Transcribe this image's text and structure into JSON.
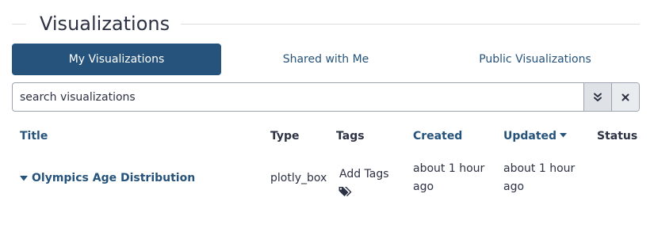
{
  "page": {
    "title": "Visualizations"
  },
  "tabs": [
    {
      "label": "My Visualizations",
      "active": true
    },
    {
      "label": "Shared with Me",
      "active": false
    },
    {
      "label": "Public Visualizations",
      "active": false
    }
  ],
  "search": {
    "placeholder": "search visualizations",
    "value": ""
  },
  "icons": {
    "advanced_search": "double-chevron-down-icon",
    "clear": "x-icon",
    "sort": "caret-down-icon",
    "expand": "caret-down-icon",
    "tags": "tags-icon"
  },
  "table": {
    "headers": {
      "title": "Title",
      "type": "Type",
      "tags": "Tags",
      "created": "Created",
      "updated": "Updated",
      "status": "Status"
    },
    "rows": [
      {
        "title": "Olympics Age Distribution",
        "type": "plotly_box",
        "tags_label": "Add Tags",
        "created_line1": "about 1 hour",
        "created_line2": "ago",
        "updated_line1": "about 1 hour",
        "updated_line2": "ago",
        "status": ""
      }
    ]
  },
  "colors": {
    "primary": "#25537b",
    "text": "#2c3143",
    "border": "#9ca3af"
  }
}
